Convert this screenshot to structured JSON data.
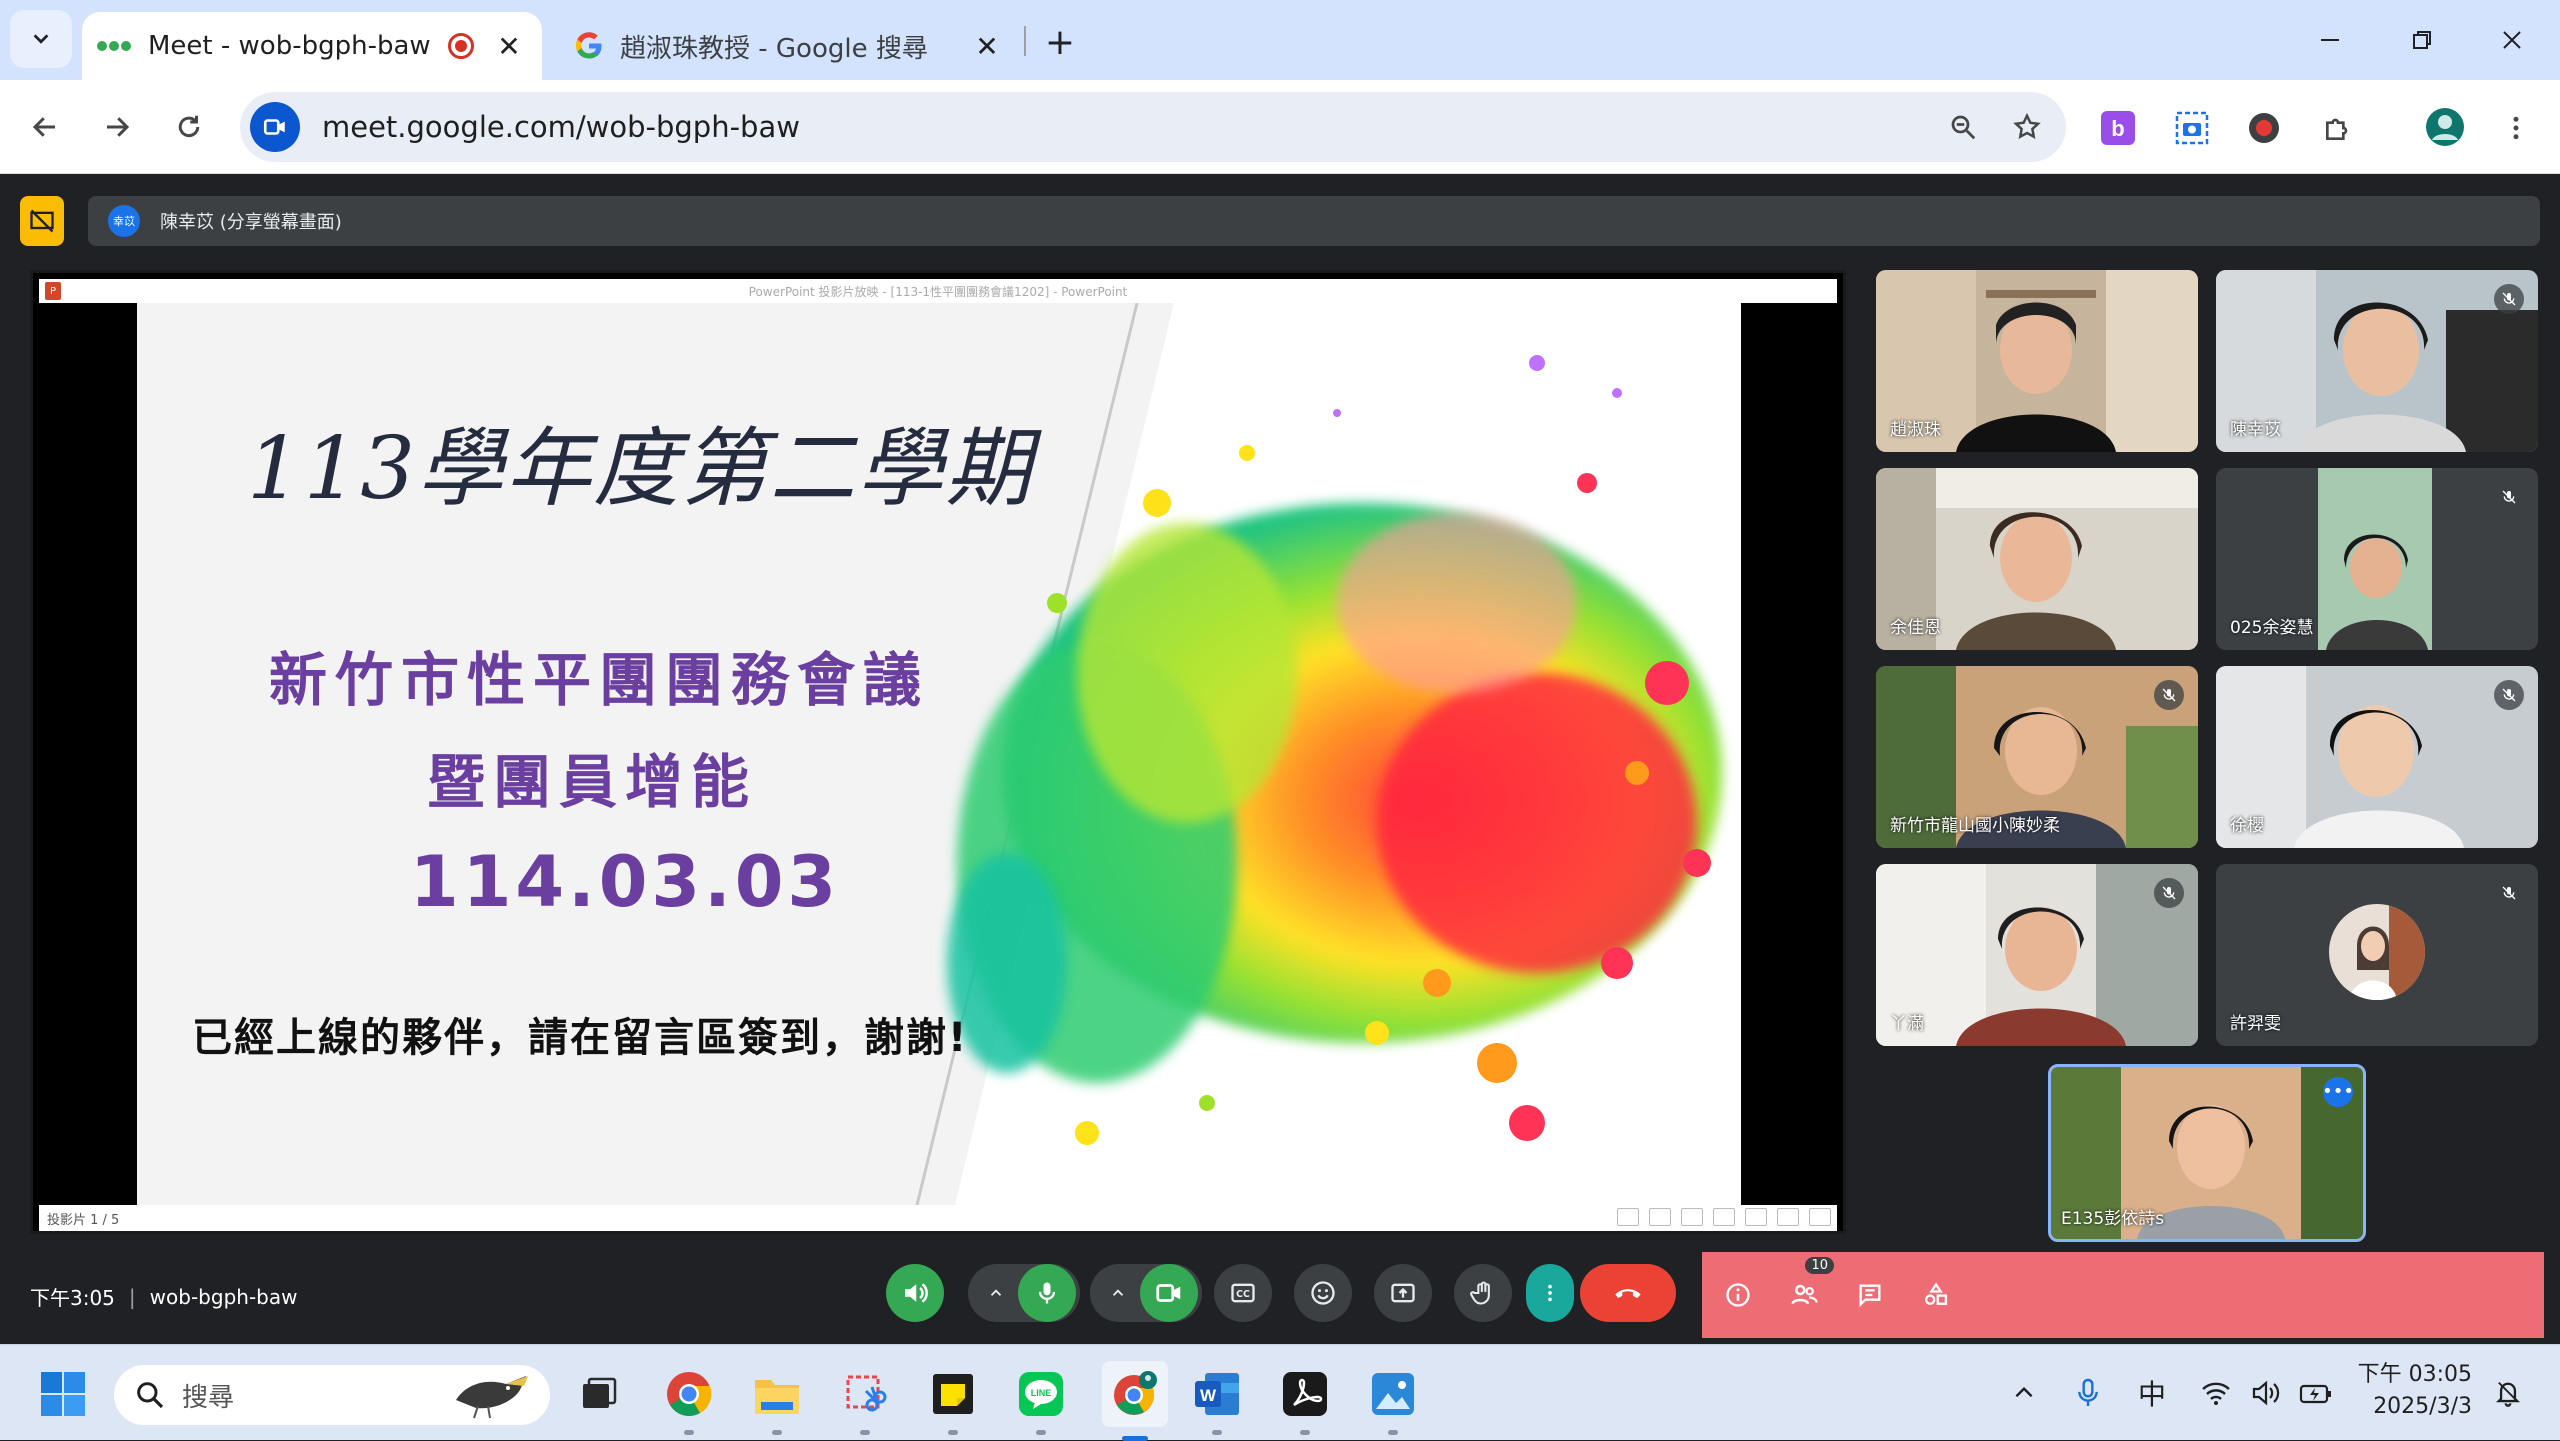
{
  "browser": {
    "tabs": [
      {
        "title": "Meet - wob-bgph-baw",
        "active": true,
        "icon": "meet-dots-icon",
        "recording": true
      },
      {
        "title": "趙淑珠教授 - Google 搜尋",
        "active": false,
        "icon": "google-g-icon"
      }
    ],
    "url": "meet.google.com/wob-bgph-baw"
  },
  "meet": {
    "share_banner": "陳幸苡 (分享螢幕畫面)",
    "share_avatar_text": "幸苡",
    "presentation": {
      "window_title": "PowerPoint 投影片放映 - [113-1性平團團務會議1202] - PowerPoint",
      "slide_title": "113學年度第二學期",
      "line1": "新竹市性平團團務會議",
      "line2": "暨團員增能",
      "date": "114.03.03",
      "note": "已經上線的夥伴，請在留言區簽到，謝謝!",
      "status": "投影片 1 / 5"
    },
    "participants": [
      {
        "name": "趙淑珠",
        "muted": false
      },
      {
        "name": "陳幸苡",
        "muted": true
      },
      {
        "name": "余佳恩",
        "muted": false
      },
      {
        "name": "025余姿慧",
        "muted": true
      },
      {
        "name": "新竹市龍山國小陳妙柔",
        "muted": true
      },
      {
        "name": "徐櫻",
        "muted": true
      },
      {
        "name": "丫滿",
        "muted": true
      },
      {
        "name": "許羿雯",
        "muted": true
      }
    ],
    "self_name": "E135彭依詩s",
    "time": "下午3:05",
    "meeting_code": "wob-bgph-baw",
    "people_count": "10"
  },
  "taskbar": {
    "search_placeholder": "搜尋",
    "ime": "中",
    "clock_time": "下午 03:05",
    "clock_date": "2025/3/3"
  },
  "colors": {
    "accent_blue": "#1a73e8",
    "leave_red": "#ea4335",
    "mic_green": "#34a853",
    "panel_red": "#ee6c73",
    "slide_purple": "#6a3fa0"
  }
}
